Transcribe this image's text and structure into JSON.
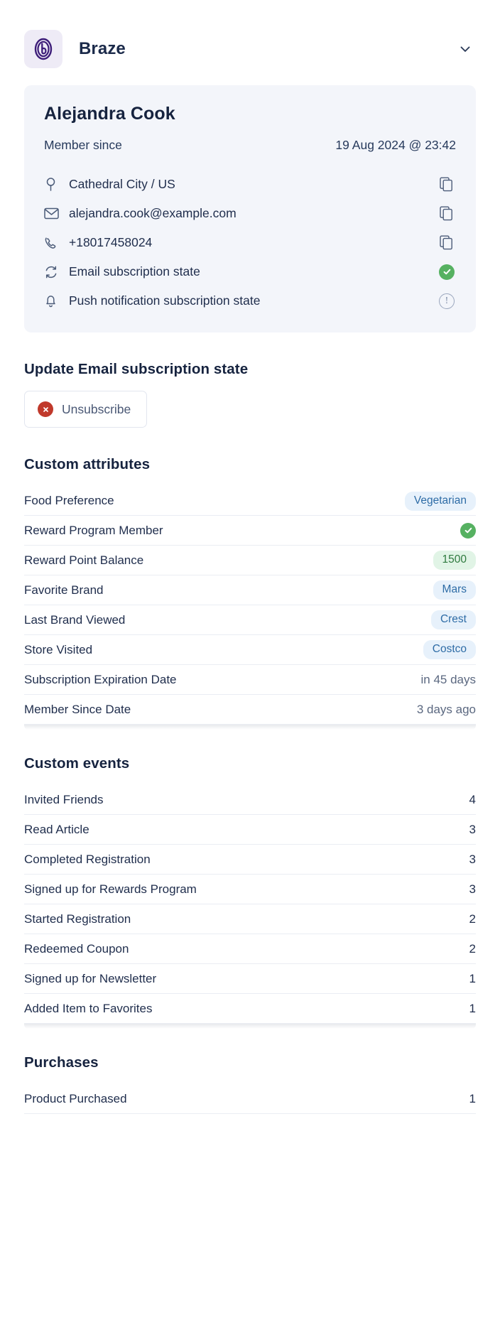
{
  "header": {
    "brand_name": "Braze",
    "logo_glyph": "b",
    "logo_bg": "#eeebf6",
    "logo_color": "#3d1d79",
    "chevron_icon": "chevron-down-icon"
  },
  "profile": {
    "name": "Alejandra Cook",
    "member_since_label": "Member since",
    "member_since_value": "19 Aug 2024 @ 23:42",
    "contacts": [
      {
        "icon": "location-pin-icon",
        "text": "Cathedral City / US",
        "action": "copy-icon",
        "action_kind": "copy"
      },
      {
        "icon": "envelope-icon",
        "text": "alejandra.cook@example.com",
        "action": "copy-icon",
        "action_kind": "copy"
      },
      {
        "icon": "phone-icon",
        "text": "+18017458024",
        "action": "copy-icon",
        "action_kind": "copy"
      },
      {
        "icon": "sync-icon",
        "text": "Email subscription state",
        "action": "check-circle-icon",
        "action_kind": "status-ok"
      },
      {
        "icon": "bell-icon",
        "text": "Push notification subscription state",
        "action": "exclamation-circle-icon",
        "action_kind": "status-warn"
      }
    ]
  },
  "update_subscription": {
    "title": "Update Email subscription state",
    "button_label": "Unsubscribe",
    "button_icon": "circle-x-icon",
    "button_icon_color": "#c0392b"
  },
  "custom_attributes": {
    "title": "Custom attributes",
    "rows": [
      {
        "label": "Food Preference",
        "value": "Vegetarian",
        "value_kind": "badge-blue"
      },
      {
        "label": "Reward Program Member",
        "value": "",
        "value_kind": "status-ok"
      },
      {
        "label": "Reward Point Balance",
        "value": "1500",
        "value_kind": "badge-green"
      },
      {
        "label": "Favorite Brand",
        "value": "Mars",
        "value_kind": "badge-blue"
      },
      {
        "label": "Last Brand Viewed",
        "value": "Crest",
        "value_kind": "badge-blue"
      },
      {
        "label": "Store Visited",
        "value": "Costco",
        "value_kind": "badge-blue"
      },
      {
        "label": "Subscription Expiration Date",
        "value": "in 45 days",
        "value_kind": "plain"
      },
      {
        "label": "Member Since Date",
        "value": "3 days ago",
        "value_kind": "plain"
      }
    ]
  },
  "custom_events": {
    "title": "Custom events",
    "rows": [
      {
        "label": "Invited Friends",
        "value": "4"
      },
      {
        "label": "Read Article",
        "value": "3"
      },
      {
        "label": "Completed Registration",
        "value": "3"
      },
      {
        "label": "Signed up for Rewards Program",
        "value": "3"
      },
      {
        "label": "Started Registration",
        "value": "2"
      },
      {
        "label": "Redeemed Coupon",
        "value": "2"
      },
      {
        "label": "Signed up for Newsletter",
        "value": "1"
      },
      {
        "label": "Added Item to Favorites",
        "value": "1"
      }
    ]
  },
  "purchases": {
    "title": "Purchases",
    "rows": [
      {
        "label": "Product Purchased",
        "value": "1"
      }
    ]
  },
  "colors": {
    "accent_purple": "#3d1d79",
    "status_ok_green": "#56b161",
    "status_warn_grey": "#9aa6bd",
    "danger_red": "#c0392b",
    "badge_blue_bg": "#e7f1fb",
    "badge_blue_text": "#2e6ca6",
    "badge_green_bg": "#e1f4e6",
    "badge_green_text": "#2f7a3f",
    "card_bg": "#f3f5fa"
  }
}
